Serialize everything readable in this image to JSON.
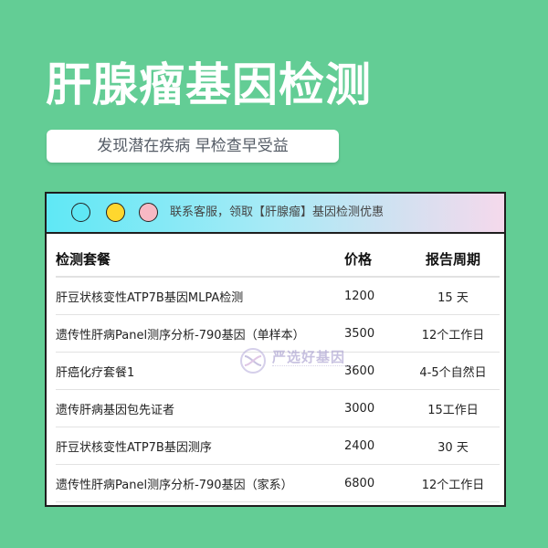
{
  "header": {
    "title": "肝腺瘤基因检测",
    "subtitle": "发现潜在疾病 早检查早受益"
  },
  "window": {
    "bar_text": "联系客服，领取【肝腺瘤】基因检测优惠",
    "dot_colors": [
      "#5fe8f5",
      "#ffd72e",
      "#f7b9c4"
    ]
  },
  "table": {
    "headers": {
      "name": "检测套餐",
      "price": "价格",
      "cycle": "报告周期"
    },
    "rows": [
      {
        "name": "肝豆状核变性ATP7B基因MLPA检测",
        "price": "1200",
        "cycle": "15 天"
      },
      {
        "name": "遗传性肝病Panel测序分析-790基因（单样本）",
        "price": "3500",
        "cycle": "12个工作日"
      },
      {
        "name": "肝癌化疗套餐1",
        "price": "3600",
        "cycle": "4-5个自然日"
      },
      {
        "name": "遗传肝病基因包先证者",
        "price": "3000",
        "cycle": "15工作日"
      },
      {
        "name": "肝豆状核变性ATP7B基因测序",
        "price": "2400",
        "cycle": "30 天"
      },
      {
        "name": "遗传性肝病Panel测序分析-790基因（家系）",
        "price": "6800",
        "cycle": "12个工作日"
      }
    ]
  },
  "watermark": {
    "text": "严选好基因",
    "icon": "dna-logo-icon"
  }
}
